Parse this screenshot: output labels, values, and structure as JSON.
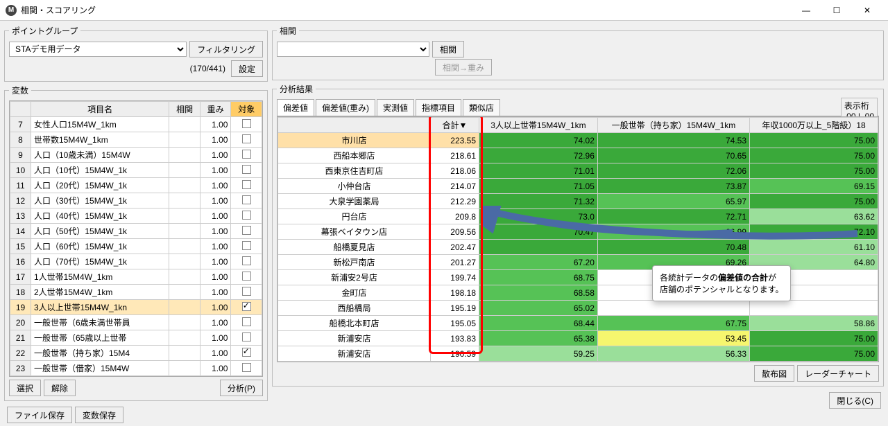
{
  "window": {
    "title": "相関・スコアリング"
  },
  "point_group": {
    "legend": "ポイントグループ",
    "dataset": "STAデモ用データ",
    "counter": "(170/441)",
    "filter_btn": "フィルタリング",
    "settings_btn": "設定"
  },
  "correlation": {
    "legend": "相関",
    "value": "",
    "correl_btn": "相関",
    "corr_to_weight_btn": "相関→重み"
  },
  "vars": {
    "legend": "変数",
    "cols": {
      "name": "項目名",
      "corr": "相関",
      "weight": "重み",
      "target": "対象"
    },
    "rows": [
      {
        "n": 7,
        "name": "女性人口15M4W_1km",
        "weight": "1.00",
        "chk": false
      },
      {
        "n": 8,
        "name": "世帯数15M4W_1km",
        "weight": "1.00",
        "chk": false
      },
      {
        "n": 9,
        "name": "人口（10歳未満）15M4W",
        "weight": "1.00",
        "chk": false
      },
      {
        "n": 10,
        "name": "人口（10代）15M4W_1k",
        "weight": "1.00",
        "chk": false
      },
      {
        "n": 11,
        "name": "人口（20代）15M4W_1k",
        "weight": "1.00",
        "chk": false
      },
      {
        "n": 12,
        "name": "人口（30代）15M4W_1k",
        "weight": "1.00",
        "chk": false
      },
      {
        "n": 13,
        "name": "人口（40代）15M4W_1k",
        "weight": "1.00",
        "chk": false
      },
      {
        "n": 14,
        "name": "人口（50代）15M4W_1k",
        "weight": "1.00",
        "chk": false
      },
      {
        "n": 15,
        "name": "人口（60代）15M4W_1k",
        "weight": "1.00",
        "chk": false
      },
      {
        "n": 16,
        "name": "人口（70代）15M4W_1k",
        "weight": "1.00",
        "chk": false
      },
      {
        "n": 17,
        "name": "1人世帯15M4W_1km",
        "weight": "1.00",
        "chk": false
      },
      {
        "n": 18,
        "name": "2人世帯15M4W_1km",
        "weight": "1.00",
        "chk": false
      },
      {
        "n": 19,
        "name": "3人以上世帯15M4W_1kn",
        "weight": "1.00",
        "chk": true,
        "sel": true
      },
      {
        "n": 20,
        "name": "一般世帯（6歳未満世帯員",
        "weight": "1.00",
        "chk": false
      },
      {
        "n": 21,
        "name": "一般世帯（65歳以上世帯",
        "weight": "1.00",
        "chk": false
      },
      {
        "n": 22,
        "name": "一般世帯（持ち家）15M4",
        "weight": "1.00",
        "chk": true
      },
      {
        "n": 23,
        "name": "一般世帯（借家）15M4W",
        "weight": "1.00",
        "chk": false
      }
    ],
    "select_btn": "選択",
    "deselect_btn": "解除",
    "analyze_btn": "分析(P)"
  },
  "results": {
    "legend": "分析結果",
    "digits_label": "表示桁",
    "tabs": [
      "偏差値",
      "偏差値(重み)",
      "実測値",
      "指標項目",
      "類似店"
    ],
    "cols": {
      "total": "合計▼",
      "c1": "3人以上世帯15M4W_1km",
      "c2": "一般世帯（持ち家）15M4W_1km",
      "c3": "年収1000万以上_5階級）18"
    },
    "rows": [
      {
        "name": "市川店",
        "total": "223.55",
        "v": [
          "74.02",
          "74.53",
          "75.00"
        ],
        "s": [
          "dg",
          "dg",
          "dg"
        ],
        "sel": true
      },
      {
        "name": "西船本郷店",
        "total": "218.61",
        "v": [
          "72.96",
          "70.65",
          "75.00"
        ],
        "s": [
          "dg",
          "dg",
          "dg"
        ]
      },
      {
        "name": "西東京住吉町店",
        "total": "218.06",
        "v": [
          "71.01",
          "72.06",
          "75.00"
        ],
        "s": [
          "dg",
          "dg",
          "dg"
        ]
      },
      {
        "name": "小仲台店",
        "total": "214.07",
        "v": [
          "71.05",
          "73.87",
          "69.15"
        ],
        "s": [
          "dg",
          "dg",
          "g"
        ]
      },
      {
        "name": "大泉学園薬局",
        "total": "212.29",
        "v": [
          "71.32",
          "65.97",
          "75.00"
        ],
        "s": [
          "dg",
          "g",
          "dg"
        ]
      },
      {
        "name": "円台店",
        "total": "209.8",
        "v": [
          "73.0",
          "72.71",
          "63.62"
        ],
        "s": [
          "dg",
          "dg",
          "lg"
        ]
      },
      {
        "name": "幕張ベイタウン店",
        "total": "209.56",
        "v": [
          "70.47",
          "66.99",
          "72.10"
        ],
        "s": [
          "dg",
          "g",
          "dg"
        ]
      },
      {
        "name": "船橋夏見店",
        "total": "202.47",
        "v": [
          "",
          "70.48",
          "61.10"
        ],
        "s": [
          "dg",
          "dg",
          "lg"
        ]
      },
      {
        "name": "新松戸南店",
        "total": "201.27",
        "v": [
          "67.20",
          "69.26",
          "64.80"
        ],
        "s": [
          "g",
          "g",
          "lg"
        ]
      },
      {
        "name": "新浦安2号店",
        "total": "199.74",
        "v": [
          "68.75",
          "",
          ""
        ],
        "s": [
          "g",
          "",
          ""
        ]
      },
      {
        "name": "金町店",
        "total": "198.18",
        "v": [
          "68.58",
          "",
          ""
        ],
        "s": [
          "g",
          "",
          ""
        ]
      },
      {
        "name": "西船橋局",
        "total": "195.19",
        "v": [
          "65.02",
          "",
          ""
        ],
        "s": [
          "g",
          "",
          ""
        ]
      },
      {
        "name": "船橋北本町店",
        "total": "195.05",
        "v": [
          "68.44",
          "67.75",
          "58.86"
        ],
        "s": [
          "g",
          "g",
          "lg"
        ]
      },
      {
        "name": "新浦安店",
        "total": "193.83",
        "v": [
          "65.38",
          "53.45",
          "75.00"
        ],
        "s": [
          "g",
          "y",
          "dg"
        ]
      },
      {
        "name": "新浦安店",
        "total": "190.59",
        "v": [
          "59.25",
          "56.33",
          "75.00"
        ],
        "s": [
          "lg",
          "lg",
          "dg"
        ]
      }
    ],
    "scatter_btn": "散布図",
    "radar_btn": "レーダーチャート"
  },
  "callout": {
    "line1_a": "各統計データの",
    "line1_b": "偏差値の合計",
    "line1_c": "が",
    "line2": "店舗のポテンシャルとなります。"
  },
  "footer": {
    "save_file": "ファイル保存",
    "save_vars": "変数保存",
    "close": "閉じる(C)"
  }
}
